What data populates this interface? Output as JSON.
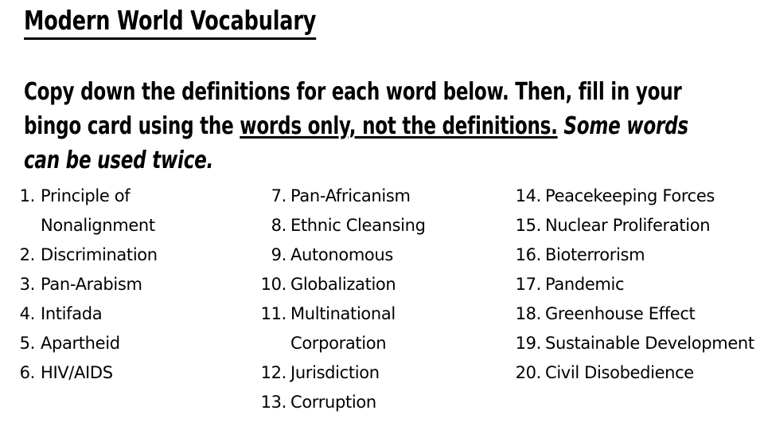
{
  "slide": {
    "title": "Modern World Vocabulary",
    "instructions": {
      "part1": "Copy down the definitions for each word below. Then, fill in your bingo card using the ",
      "part2_underlined": "words only, not the definitions.",
      "part3_italic": " Some words can be used twice."
    },
    "columns": [
      {
        "name": "column-1",
        "items": [
          {
            "number": "1.",
            "text": "Principle of Nonalignment"
          },
          {
            "number": "2.",
            "text": "Discrimination"
          },
          {
            "number": "3.",
            "text": "Pan-Arabism"
          },
          {
            "number": "4.",
            "text": "Intifada"
          },
          {
            "number": "5.",
            "text": "Apartheid"
          },
          {
            "number": "6.",
            "text": "HIV/AIDS"
          }
        ]
      },
      {
        "name": "column-2",
        "items": [
          {
            "number": "7.",
            "text": "Pan-Africanism"
          },
          {
            "number": "8.",
            "text": "Ethnic Cleansing"
          },
          {
            "number": "9.",
            "text": "Autonomous"
          },
          {
            "number": "10.",
            "text": "Globalization"
          },
          {
            "number": "11.",
            "text": "Multinational Corporation"
          },
          {
            "number": "12.",
            "text": "Jurisdiction"
          },
          {
            "number": "13.",
            "text": "Corruption"
          }
        ]
      },
      {
        "name": "column-3",
        "items": [
          {
            "number": "14.",
            "text": "Peacekeeping Forces"
          },
          {
            "number": "15.",
            "text": "Nuclear Proliferation"
          },
          {
            "number": "16.",
            "text": "Bioterrorism"
          },
          {
            "number": "17.",
            "text": "Pandemic"
          },
          {
            "number": "18.",
            "text": "Greenhouse Effect"
          },
          {
            "number": "19.",
            "text": "Sustainable Development"
          },
          {
            "number": "20.",
            "text": "Civil Disobedience"
          }
        ]
      }
    ],
    "colors": {
      "background": "#ffffff",
      "text": "#000000"
    }
  }
}
